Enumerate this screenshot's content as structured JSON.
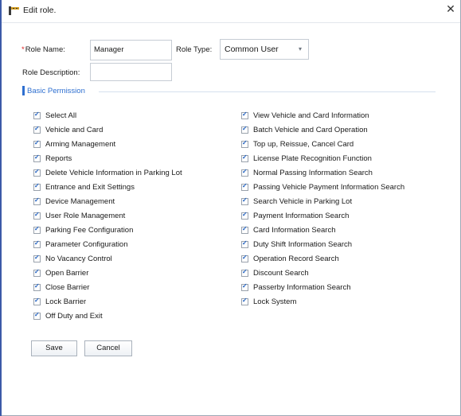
{
  "window": {
    "title": "Edit role.",
    "close_glyph": "✕"
  },
  "form": {
    "role_name_required_mark": "*",
    "role_name_label": "Role Name:",
    "role_name_value": "Manager",
    "role_type_label": "Role Type:",
    "role_type_value": "Common User",
    "role_description_label": "Role Description:",
    "role_description_value": ""
  },
  "section": {
    "title": "Basic Permission"
  },
  "permissions_left": [
    {
      "label": "Select All",
      "checked": true
    },
    {
      "label": "Vehicle and Card",
      "checked": true
    },
    {
      "label": "Arming Management",
      "checked": true
    },
    {
      "label": "Reports",
      "checked": true
    },
    {
      "label": "Delete Vehicle Information in Parking Lot",
      "checked": true
    },
    {
      "label": "Entrance and Exit Settings",
      "checked": true
    },
    {
      "label": "Device Management",
      "checked": true
    },
    {
      "label": "User Role Management",
      "checked": true
    },
    {
      "label": "Parking Fee Configuration",
      "checked": true
    },
    {
      "label": "Parameter Configuration",
      "checked": true
    },
    {
      "label": "No Vacancy Control",
      "checked": true
    },
    {
      "label": "Open Barrier",
      "checked": true
    },
    {
      "label": "Close Barrier",
      "checked": true
    },
    {
      "label": "Lock Barrier",
      "checked": true
    },
    {
      "label": "Off Duty and Exit",
      "checked": true
    }
  ],
  "permissions_right": [
    {
      "label": "View Vehicle and Card Information",
      "checked": true
    },
    {
      "label": "Batch Vehicle and Card Operation",
      "checked": true
    },
    {
      "label": "Top up, Reissue, Cancel Card",
      "checked": true
    },
    {
      "label": "License Plate Recognition Function",
      "checked": true
    },
    {
      "label": "Normal Passing Information Search",
      "checked": true
    },
    {
      "label": "Passing Vehicle Payment Information Search",
      "checked": true
    },
    {
      "label": "Search Vehicle in Parking Lot",
      "checked": true
    },
    {
      "label": "Payment Information Search",
      "checked": true
    },
    {
      "label": "Card Information Search",
      "checked": true
    },
    {
      "label": "Duty Shift Information Search",
      "checked": true
    },
    {
      "label": "Operation Record Search",
      "checked": true
    },
    {
      "label": "Discount Search",
      "checked": true
    },
    {
      "label": "Passerby Information Search",
      "checked": true
    },
    {
      "label": "Lock System",
      "checked": true
    }
  ],
  "buttons": {
    "save": "Save",
    "cancel": "Cancel"
  },
  "icons": {
    "app": "parking-app-icon",
    "close": "close-icon",
    "dropdown": "chevron-down-icon",
    "checkbox": "checkmark-icon"
  },
  "colors": {
    "accent": "#2e6fd0",
    "required": "#e02020",
    "window_edge": "#3c5aa8"
  }
}
